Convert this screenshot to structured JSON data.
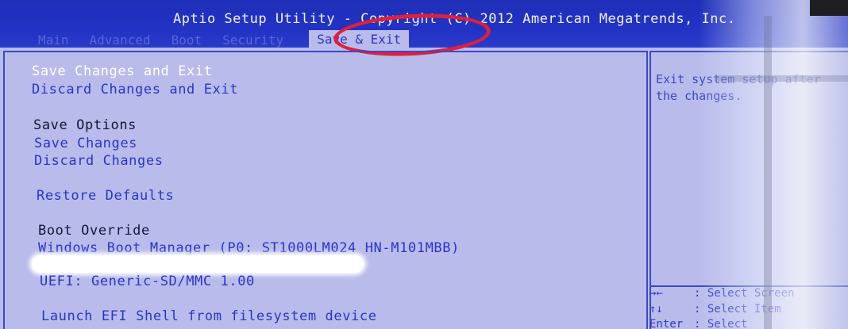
{
  "header": {
    "title": "Aptio Setup Utility - Copyright (C) 2012 American Megatrends, Inc.",
    "tabs": [
      {
        "label": "Main"
      },
      {
        "label": "Advanced"
      },
      {
        "label": "Boot"
      },
      {
        "label": "Security"
      },
      {
        "label": "Save & Exit",
        "active": true
      }
    ]
  },
  "menu": {
    "save_changes_and_exit": "Save Changes and Exit",
    "discard_changes_and_exit": "Discard Changes and Exit",
    "save_options_heading": "Save Options",
    "save_changes": "Save Changes",
    "discard_changes": "Discard Changes",
    "restore_defaults": "Restore Defaults",
    "boot_override_heading": "Boot Override",
    "windows_boot_manager": "Windows Boot Manager (P0: ST1000LM024 HN-M101MBB)",
    "uefi_sd": "UEFI: Generic-SD/MMC 1.00",
    "launch_efi_shell": "Launch EFI Shell from filesystem device"
  },
  "help": {
    "line1": "Exit system setup after",
    "line2": "the changes."
  },
  "keys": [
    {
      "key": "→←",
      "action": ": Select Screen"
    },
    {
      "key": "↑↓",
      "action": ": Select Item"
    },
    {
      "key": "Enter",
      "action": ": Select"
    }
  ],
  "colors": {
    "header_bg": "#2232c4",
    "body_bg": "#b9bcea",
    "selected_text": "#ffffff",
    "link_text": "#2a34c9",
    "annotation": "#e0203a"
  }
}
